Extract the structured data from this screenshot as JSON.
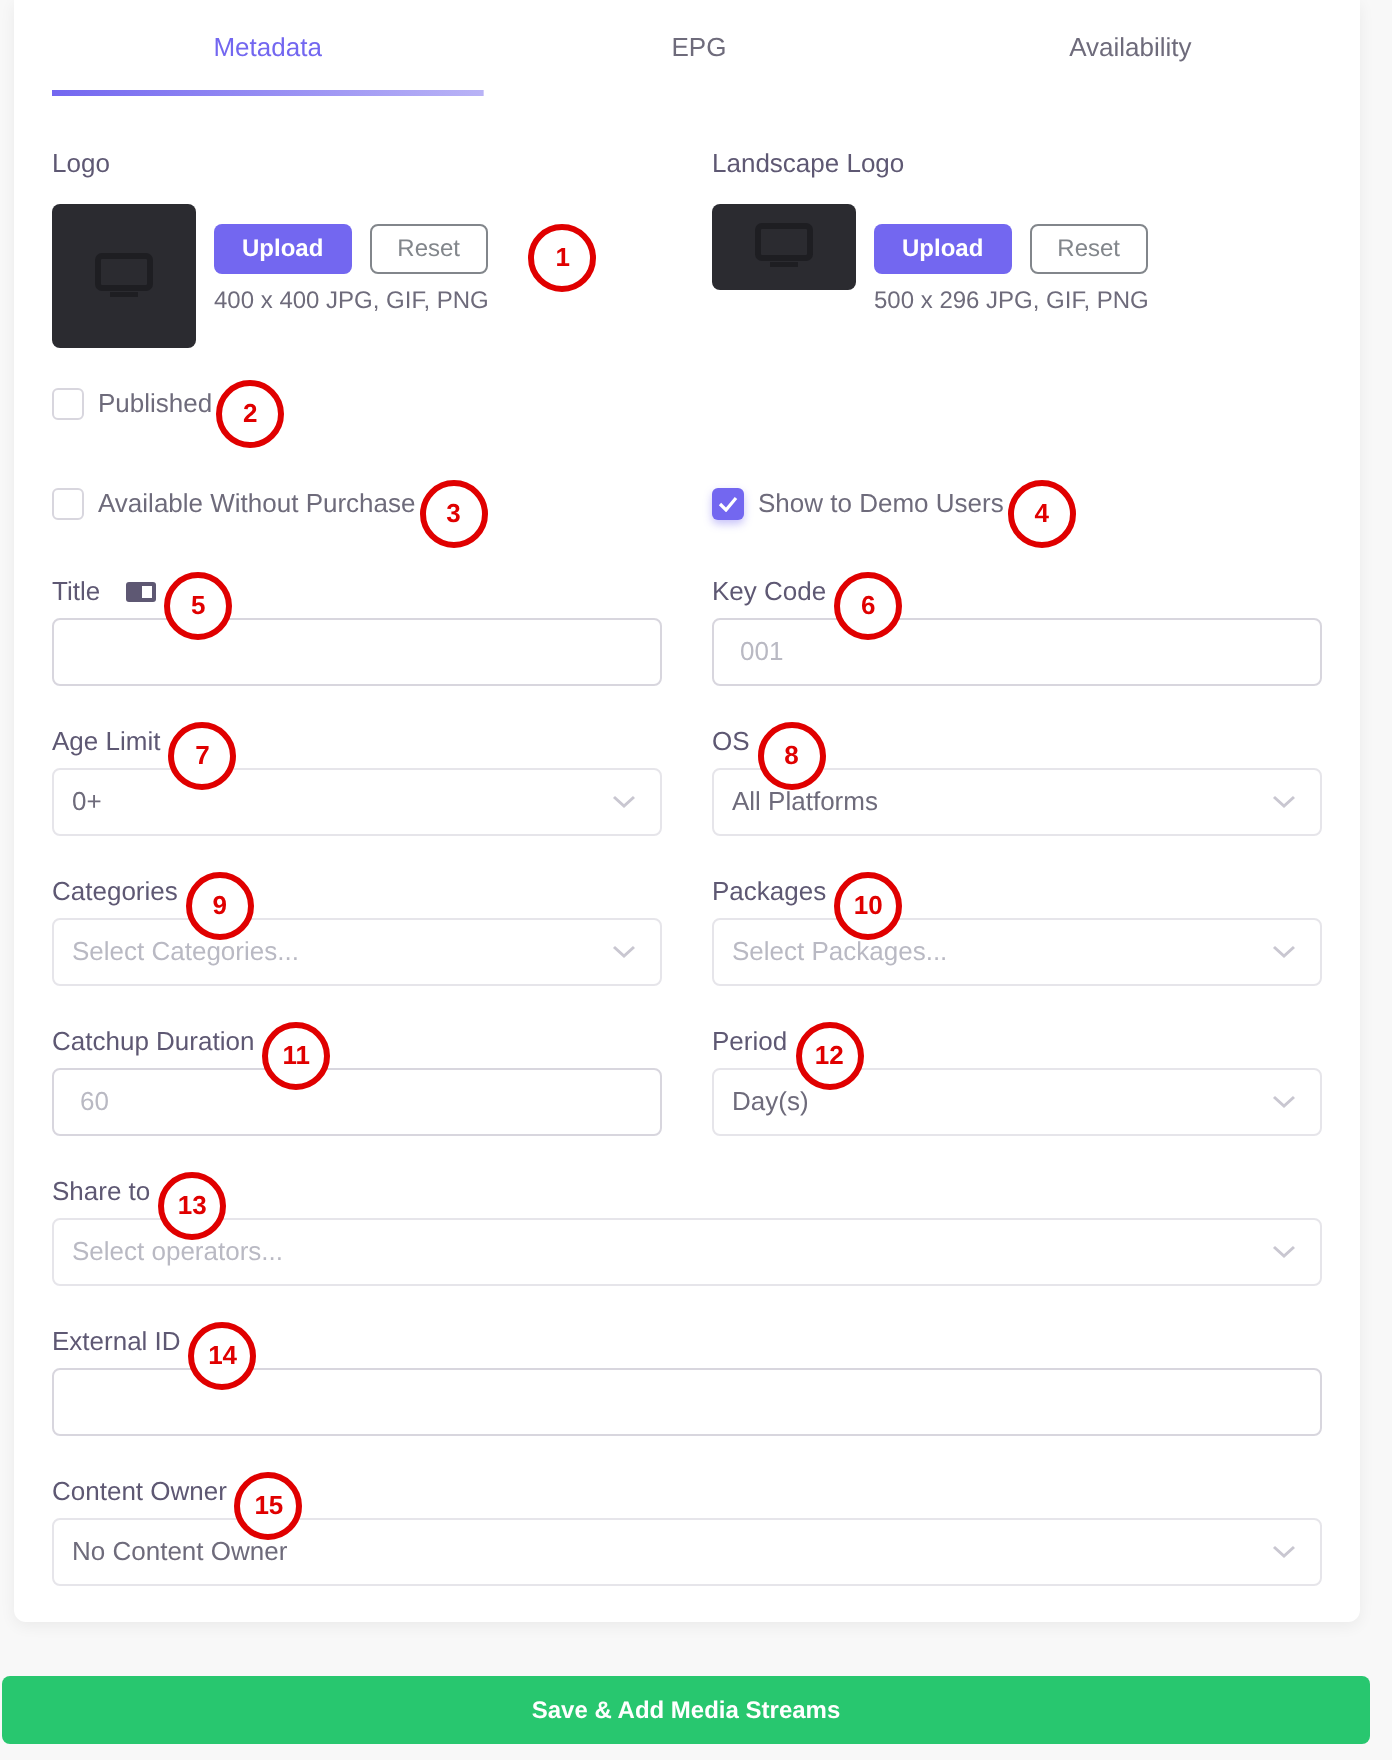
{
  "tabs": [
    {
      "label": "Metadata",
      "selected": true
    },
    {
      "label": "EPG",
      "selected": false
    },
    {
      "label": "Availability",
      "selected": false
    }
  ],
  "logos": [
    {
      "label": "Logo",
      "upload": "Upload",
      "reset": "Reset",
      "hint": "400 x 400 JPG, GIF, PNG",
      "callout": "1"
    },
    {
      "label": "Landscape Logo",
      "upload": "Upload",
      "reset": "Reset",
      "hint": "500 x 296 JPG, GIF, PNG"
    }
  ],
  "checkbox_rows": [
    [
      {
        "label": "Published",
        "checked": false,
        "callout": "2"
      }
    ],
    [
      {
        "label": "Available Without Purchase",
        "checked": false,
        "callout": "3"
      },
      {
        "label": "Show to Demo Users",
        "checked": true,
        "callout": "4"
      }
    ]
  ],
  "field_rows": [
    [
      {
        "label": "Title",
        "kind": "input",
        "translate": true,
        "callout": "5"
      },
      {
        "label": "Key Code",
        "kind": "input",
        "placeholder": "001",
        "callout": "6"
      }
    ],
    [
      {
        "label": "Age Limit",
        "kind": "select",
        "value": "0+",
        "callout": "7"
      },
      {
        "label": "OS",
        "kind": "select",
        "value": "All Platforms",
        "callout": "8"
      }
    ],
    [
      {
        "label": "Categories",
        "kind": "select",
        "placeholder": "Select Categories...",
        "callout": "9"
      },
      {
        "label": "Packages",
        "kind": "select",
        "placeholder": "Select Packages...",
        "callout": "10"
      }
    ],
    [
      {
        "label": "Catchup Duration",
        "kind": "input",
        "placeholder": "60",
        "callout": "11"
      },
      {
        "label": "Period",
        "kind": "select",
        "value": "Day(s)",
        "callout": "12"
      }
    ],
    [
      {
        "label": "Share to",
        "kind": "select",
        "placeholder": "Select operators...",
        "callout": "13"
      }
    ],
    [
      {
        "label": "External ID",
        "kind": "input",
        "callout": "14"
      }
    ],
    [
      {
        "label": "Content Owner",
        "kind": "select",
        "value": "No Content Owner",
        "callout": "15"
      }
    ]
  ],
  "save_button": "Save & Add Media Streams"
}
